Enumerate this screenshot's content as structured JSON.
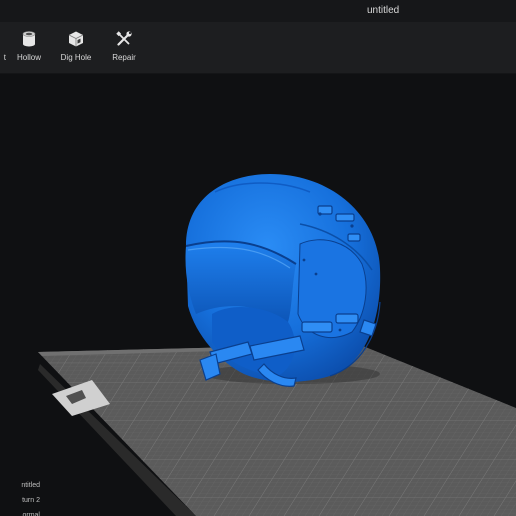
{
  "window": {
    "title": "untitled"
  },
  "toolbar": {
    "items": [
      {
        "label": "t",
        "icon": "cut-icon"
      },
      {
        "label": "Hollow",
        "icon": "cylinder-icon"
      },
      {
        "label": "Dig Hole",
        "icon": "cube-hole-icon"
      },
      {
        "label": "Repair",
        "icon": "wrench-screwdriver-icon"
      }
    ]
  },
  "viewport": {
    "background": "#0f1012",
    "model_color": "#1a78e6",
    "build_plate_color": "#5c5c5c",
    "plate_grid_color": "#6c6c6c"
  },
  "status": {
    "project": "ntitled",
    "machine": "turn 2",
    "mode": "ormal"
  }
}
